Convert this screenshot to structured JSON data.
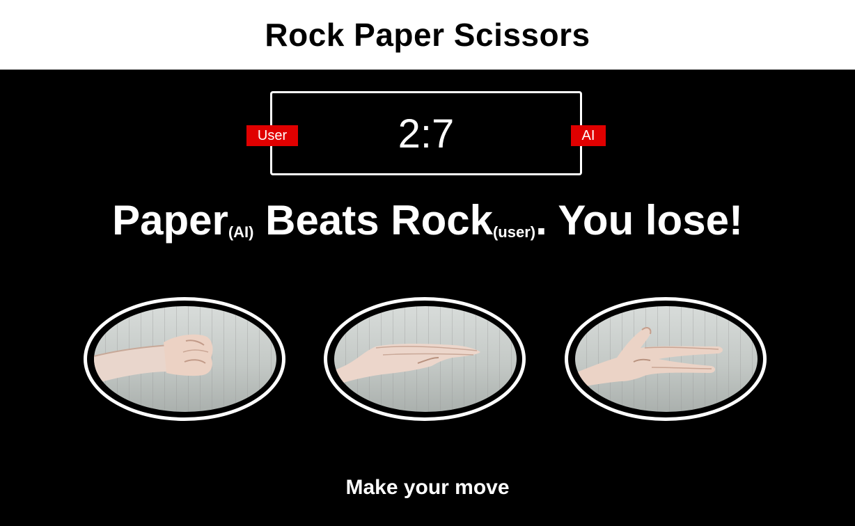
{
  "header": {
    "title": "Rock Paper Scissors"
  },
  "scoreboard": {
    "score": "2:7",
    "user_label": "User",
    "ai_label": "AI",
    "tag_color": "#e00000"
  },
  "result": {
    "winner_move": "Paper",
    "winner_tag": "(AI)",
    "verb": " Beats ",
    "loser_move": "Rock",
    "loser_tag": "(user)",
    "outcome": ". You lose!"
  },
  "choices": [
    {
      "move": "rock",
      "icon": "rock-hand-icon"
    },
    {
      "move": "paper",
      "icon": "paper-hand-icon"
    },
    {
      "move": "scissors",
      "icon": "scissors-hand-icon"
    }
  ],
  "prompt": {
    "text": "Make your move"
  }
}
